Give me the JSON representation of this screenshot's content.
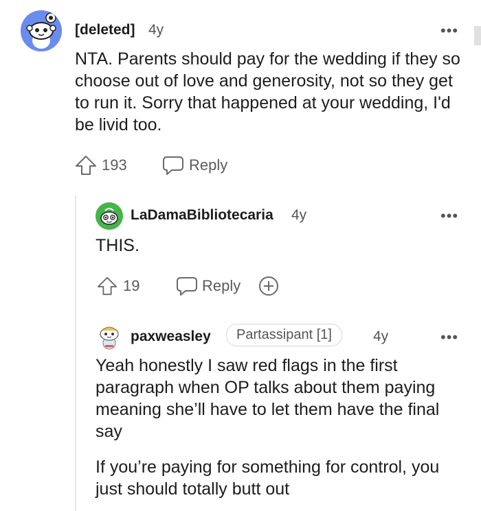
{
  "comments": [
    {
      "username": "[deleted]",
      "age": "4y",
      "text": "NTA. Parents should pay for the wedding if they so choose out of love and generosity, not so they get to run it. Sorry that happened at your wedding, I'd be livid too.",
      "upvotes": "193",
      "reply_label": "Reply",
      "more_label": "•••",
      "avatar_icon": "snoo-avatar-icon",
      "accent": "#5a7de6"
    },
    {
      "username": "LaDamaBibliotecaria",
      "age": "4y",
      "text": "THIS.",
      "upvotes": "19",
      "reply_label": "Reply",
      "more_label": "•••",
      "avatar_icon": "snoo-avatar-icon",
      "accent": "#46b44b"
    },
    {
      "username": "paxweasley",
      "flair": "Partassipant [1]",
      "age": "4y",
      "paragraphs": [
        "Yeah honestly I saw red flags in the first paragraph when OP talks about them paying meaning she’ll have to let them have the final say",
        "If you’re paying for something for control, you just should totally butt out"
      ],
      "more_label": "•••",
      "avatar_icon": "snoo-avatar-icon"
    }
  ]
}
